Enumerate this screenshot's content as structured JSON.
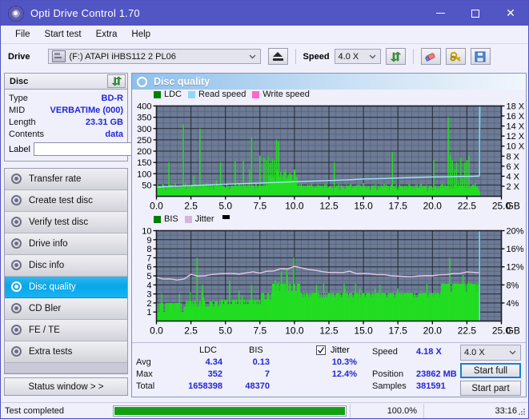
{
  "window": {
    "title": "Opti Drive Control 1.70",
    "icon": "disc-icon",
    "minimize": "–",
    "maximize": "□",
    "close": "✕"
  },
  "menu": [
    "File",
    "Start test",
    "Extra",
    "Help"
  ],
  "toolbar": {
    "drive_label": "Drive",
    "drive_value": "(F:)  ATAPI iHBS112  2 PL06",
    "eject_title": "eject-button",
    "speed_label": "Speed",
    "speed_value": "4.0 X",
    "refresh_title": "refresh-button",
    "eraser_title": "eraser-button",
    "key_title": "key-button",
    "save_title": "save-button"
  },
  "disc": {
    "panel_title": "Disc",
    "refresh_icon": "refresh-icon",
    "rows": [
      {
        "key": "Type",
        "value": "BD-R"
      },
      {
        "key": "MID",
        "value": "VERBATIMe (000)"
      },
      {
        "key": "Length",
        "value": "23.31 GB"
      },
      {
        "key": "Contents",
        "value": "data"
      }
    ],
    "label_key": "Label",
    "label_value": "",
    "label_placeholder": ""
  },
  "nav": {
    "items": [
      {
        "id": "transfer-rate",
        "label": "Transfer rate",
        "selected": false
      },
      {
        "id": "create-test-disc",
        "label": "Create test disc",
        "selected": false
      },
      {
        "id": "verify-test-disc",
        "label": "Verify test disc",
        "selected": false
      },
      {
        "id": "drive-info",
        "label": "Drive info",
        "selected": false
      },
      {
        "id": "disc-info",
        "label": "Disc info",
        "selected": false
      },
      {
        "id": "disc-quality",
        "label": "Disc quality",
        "selected": true
      },
      {
        "id": "cd-bler",
        "label": "CD Bler",
        "selected": false
      },
      {
        "id": "fe-te",
        "label": "FE / TE",
        "selected": false
      },
      {
        "id": "extra-tests",
        "label": "Extra tests",
        "selected": false
      }
    ],
    "status_window": "Status window > >"
  },
  "main": {
    "title": "Disc quality",
    "icon": "disc-quality-icon"
  },
  "chart_data": [
    {
      "id": "ldc-chart",
      "type": "line",
      "title": "",
      "legend": [
        {
          "label": "LDC",
          "color": "#00a000"
        },
        {
          "label": "Read speed",
          "color": "#8fd8f5"
        },
        {
          "label": "Write speed",
          "color": "#ff66cc"
        }
      ],
      "legend_position": "top-left",
      "grid": true,
      "xlabel": "GB",
      "x_ticks": [
        "0.0",
        "2.5",
        "5.0",
        "7.5",
        "10.0",
        "12.5",
        "15.0",
        "17.5",
        "20.0",
        "22.5",
        "25.0"
      ],
      "xlim": [
        0,
        25
      ],
      "ylabel": "",
      "y_ticks": [
        "50",
        "100",
        "150",
        "200",
        "250",
        "300",
        "350",
        "400"
      ],
      "ylim": [
        0,
        400
      ],
      "y2label": "",
      "y2_ticks": [
        "2 X",
        "4 X",
        "6 X",
        "8 X",
        "10 X",
        "12 X",
        "14 X",
        "16 X",
        "18 X"
      ],
      "y2lim": [
        0,
        18
      ],
      "series": [
        {
          "name": "LDC",
          "color": "#22cc22",
          "kind": "impulse",
          "x": [
            0.05,
            0.15,
            0.3,
            0.45,
            0.6,
            0.75,
            0.9,
            1.05,
            1.2,
            1.35,
            1.5,
            1.65,
            1.8,
            1.95,
            2.1,
            2.25,
            2.4,
            2.55,
            2.7,
            2.85,
            3.0,
            3.15,
            3.3,
            3.45,
            3.6,
            3.75,
            3.9,
            4.05,
            4.2,
            4.35,
            4.5,
            4.65,
            4.8,
            4.95,
            5.1,
            5.25,
            5.4,
            5.55,
            5.7,
            5.85,
            6.0,
            6.15,
            6.3,
            6.45,
            6.6,
            6.75,
            6.9,
            7.05,
            7.2,
            7.35,
            7.5,
            7.65,
            7.8,
            7.95,
            8.1,
            8.25,
            8.4,
            8.55,
            8.7,
            8.85,
            9.0,
            9.15,
            9.3,
            9.45,
            9.6,
            9.75,
            9.9,
            10.05,
            10.2,
            10.35,
            10.5,
            10.65,
            10.8,
            10.95,
            11.1,
            11.25,
            11.4,
            11.55,
            11.7,
            11.85,
            12.0,
            12.3,
            12.6,
            12.9,
            13.2,
            13.5,
            13.8,
            14.1,
            14.4,
            14.7,
            15.0,
            15.3,
            15.6,
            15.9,
            16.2,
            16.5,
            16.8,
            17.1,
            17.4,
            17.7,
            18.0,
            18.3,
            18.6,
            18.9,
            19.2,
            19.5,
            19.8,
            20.1,
            20.4,
            20.7,
            21.0,
            21.15,
            21.3,
            21.45,
            21.6,
            21.75,
            21.9,
            22.05,
            22.2,
            22.35,
            22.5,
            22.65,
            22.8,
            22.95,
            23.1,
            23.25
          ],
          "y": [
            60,
            45,
            40,
            55,
            48,
            42,
            150,
            50,
            44,
            60,
            42,
            38,
            45,
            320,
            60,
            50,
            46,
            42,
            90,
            55,
            48,
            300,
            52,
            46,
            58,
            44,
            40,
            52,
            46,
            70,
            44,
            150,
            48,
            42,
            56,
            44,
            40,
            48,
            156,
            42,
            58,
            44,
            156,
            50,
            46,
            120,
            262,
            44,
            58,
            42,
            180,
            48,
            170,
            160,
            178,
            150,
            165,
            160,
            250,
            240,
            60,
            48,
            56,
            44,
            52,
            40,
            48,
            56,
            44,
            52,
            58,
            44,
            48,
            52,
            40,
            56,
            44,
            48,
            52,
            44,
            48,
            56,
            44,
            150,
            52,
            40,
            48,
            56,
            44,
            52,
            58,
            44,
            48,
            52,
            40,
            56,
            44,
            196,
            52,
            44,
            48,
            56,
            44,
            52,
            58,
            44,
            48,
            160,
            40,
            56,
            44,
            350,
            180,
            160,
            120,
            150,
            60,
            170,
            80,
            150,
            160,
            180,
            44,
            52,
            58,
            44
          ]
        },
        {
          "name": "Read speed",
          "color": "#8fd8f5",
          "kind": "line",
          "x": [
            0,
            1,
            2,
            3,
            4,
            5,
            6,
            7,
            8,
            9,
            10,
            11,
            12,
            13,
            14,
            15,
            16,
            17,
            18,
            19,
            20,
            21,
            22,
            23,
            23.4,
            23.45
          ],
          "y_speed": [
            1.8,
            2.0,
            2.1,
            2.2,
            2.3,
            2.4,
            2.5,
            2.6,
            2.7,
            2.8,
            2.9,
            3.0,
            3.1,
            3.2,
            3.3,
            3.45,
            3.5,
            3.6,
            3.7,
            3.8,
            3.85,
            3.9,
            3.95,
            4.0,
            4.05,
            18
          ]
        }
      ]
    },
    {
      "id": "bis-jitter-chart",
      "type": "line",
      "title": "",
      "legend": [
        {
          "label": "BIS",
          "color": "#00a000"
        },
        {
          "label": "Jitter",
          "color": "#d8b4d8"
        },
        {
          "label": "",
          "color": "#000000"
        }
      ],
      "legend_position": "top-left",
      "grid": true,
      "xlabel": "GB",
      "x_ticks": [
        "0.0",
        "2.5",
        "5.0",
        "7.5",
        "10.0",
        "12.5",
        "15.0",
        "17.5",
        "20.0",
        "22.5",
        "25.0"
      ],
      "xlim": [
        0,
        25
      ],
      "y_ticks": [
        "1",
        "2",
        "3",
        "4",
        "5",
        "6",
        "7",
        "8",
        "9",
        "10"
      ],
      "ylim": [
        0,
        10
      ],
      "y2_ticks": [
        "4%",
        "8%",
        "12%",
        "16%",
        "20%"
      ],
      "y2lim": [
        0,
        20
      ],
      "series": [
        {
          "name": "BIS",
          "color": "#22cc22",
          "kind": "impulse",
          "note": "dense green fill around 2-3 with spikes to 4-7"
        },
        {
          "name": "Jitter",
          "color": "#e0bde0",
          "kind": "line",
          "x": [
            0,
            0.5,
            1,
            1.5,
            2,
            2.5,
            3,
            3.5,
            4,
            4.5,
            5,
            5.5,
            6,
            6.5,
            7,
            7.5,
            8,
            8.5,
            9,
            9.5,
            10,
            10.5,
            11,
            11.5,
            12,
            12.5,
            13,
            13.5,
            14,
            14.5,
            15,
            15.5,
            16,
            16.5,
            17,
            17.5,
            18,
            18.5,
            19,
            19.5,
            20,
            20.5,
            21,
            21.5,
            22,
            22.5,
            23,
            23.4
          ],
          "y_pct": [
            9.6,
            9.4,
            9.3,
            9.0,
            9.2,
            10.4,
            10.0,
            10.1,
            10.3,
            10.4,
            10.6,
            10.4,
            10.5,
            10.7,
            10.8,
            10.7,
            11.0,
            11.2,
            11.6,
            11.5,
            12.0,
            11.8,
            11.4,
            11.2,
            11.0,
            10.8,
            10.9,
            10.8,
            11.0,
            10.6,
            10.5,
            10.4,
            10.3,
            10.2,
            10.0,
            9.9,
            9.8,
            9.9,
            10.0,
            10.1,
            10.0,
            10.2,
            10.3,
            10.5,
            10.4,
            10.8,
            10.9,
            10.8
          ]
        }
      ]
    }
  ],
  "stats": {
    "col_headers": [
      "LDC",
      "BIS"
    ],
    "row_labels": [
      "Avg",
      "Max",
      "Total"
    ],
    "ldc": {
      "avg": "4.34",
      "max": "352",
      "total": "1658398"
    },
    "bis": {
      "avg": "0.13",
      "max": "7",
      "total": "48370"
    },
    "jitter_checkbox_label": "Jitter",
    "jitter_checked": true,
    "jitter_avg": "10.3%",
    "jitter_max": "12.4%",
    "speed_label": "Speed",
    "speed_value": "4.18 X",
    "position_label": "Position",
    "position_value": "23862 MB",
    "samples_label": "Samples",
    "samples_value": "381591",
    "speed_select": "4.0 X",
    "start_full": "Start full",
    "start_part": "Start part"
  },
  "statusbar": {
    "message": "Test completed",
    "progress_percent": 100,
    "progress_text": "100.0%",
    "elapsed": "33:16"
  }
}
